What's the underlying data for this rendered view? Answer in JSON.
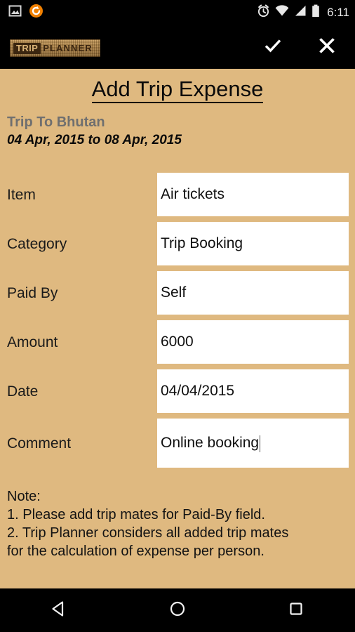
{
  "status_bar": {
    "left_icons": [
      "screenshot-image-icon",
      "sync-circle-icon"
    ],
    "right_icons": [
      "alarm-icon",
      "wifi-icon",
      "cell-signal-icon",
      "battery-icon"
    ],
    "clock": "6:11"
  },
  "action_bar": {
    "logo_primary": "TRIP",
    "logo_secondary": "PLANNER",
    "done_icon": "checkmark-icon",
    "cancel_icon": "close-x-icon"
  },
  "header": {
    "title": "Add Trip Expense",
    "trip_name": "Trip To Bhutan",
    "trip_dates": "04 Apr, 2015 to 08 Apr, 2015"
  },
  "form": {
    "fields": [
      {
        "label": "Item",
        "value": "Air tickets",
        "placeholder": "",
        "has_caret": false,
        "multiline": false
      },
      {
        "label": "Category",
        "value": "Trip Booking",
        "placeholder": "",
        "has_caret": false,
        "multiline": false
      },
      {
        "label": "Paid By",
        "value": "Self",
        "placeholder": "",
        "has_caret": false,
        "multiline": false
      },
      {
        "label": "Amount",
        "value": "6000",
        "placeholder": "",
        "has_caret": false,
        "multiline": false
      },
      {
        "label": "Date",
        "value": "04/04/2015",
        "placeholder": "",
        "has_caret": false,
        "multiline": false
      },
      {
        "label": "Comment",
        "value": "Online booking",
        "placeholder": "",
        "has_caret": true,
        "multiline": true
      }
    ]
  },
  "note": {
    "heading": "Note:",
    "lines": [
      "1. Please add trip mates for Paid-By field.",
      "2. Trip Planner considers all added trip mates",
      "for the calculation of expense per person."
    ]
  },
  "nav_bar": {
    "back_icon": "back-triangle-icon",
    "home_icon": "home-circle-icon",
    "recents_icon": "recents-square-icon"
  },
  "colors": {
    "background": "#dfb980",
    "bar": "#000000",
    "field": "#ffffff",
    "accent_orange": "#f08000",
    "muted_text": "#6f6f6f"
  }
}
